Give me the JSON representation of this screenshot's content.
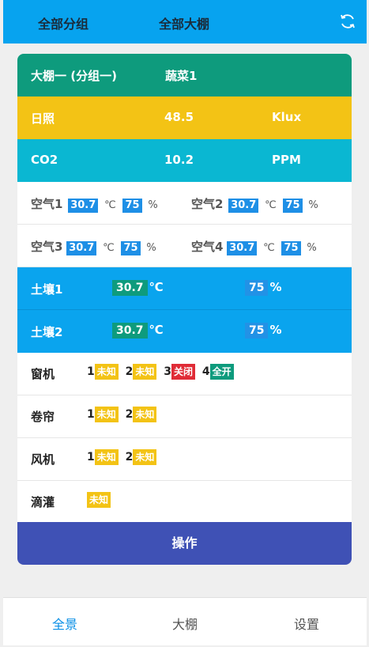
{
  "header": {
    "tab_group": "全部分组",
    "tab_greenhouse": "全部大棚",
    "refresh_icon": "refresh-icon"
  },
  "card": {
    "title": {
      "name": "大棚一 (分组一)",
      "crop": "蔬菜1"
    },
    "light": {
      "label": "日照",
      "value": "48.5",
      "unit": "Klux"
    },
    "co2": {
      "label": "CO2",
      "value": "10.2",
      "unit": "PPM"
    },
    "air": [
      {
        "label": "空气1",
        "temp": "30.7",
        "temp_unit": "℃",
        "hum": "75",
        "hum_unit": "%"
      },
      {
        "label": "空气2",
        "temp": "30.7",
        "temp_unit": "℃",
        "hum": "75",
        "hum_unit": "%"
      },
      {
        "label": "空气3",
        "temp": "30.7",
        "temp_unit": "℃",
        "hum": "75",
        "hum_unit": "%"
      },
      {
        "label": "空气4",
        "temp": "30.7",
        "temp_unit": "℃",
        "hum": "75",
        "hum_unit": "%"
      }
    ],
    "soil": [
      {
        "label": "土壤1",
        "temp": "30.7",
        "temp_unit": "℃",
        "hum": "75",
        "hum_unit": "%"
      },
      {
        "label": "土壤2",
        "temp": "30.7",
        "temp_unit": "℃",
        "hum": "75",
        "hum_unit": "%"
      }
    ],
    "devices": {
      "window": {
        "name": "窗机",
        "items": [
          {
            "n": "1",
            "state": "未知"
          },
          {
            "n": "2",
            "state": "未知"
          },
          {
            "n": "3",
            "state": "关闭"
          },
          {
            "n": "4",
            "state": "全开"
          }
        ]
      },
      "curtain": {
        "name": "卷帘",
        "items": [
          {
            "n": "1",
            "state": "未知"
          },
          {
            "n": "2",
            "state": "未知"
          }
        ]
      },
      "fan": {
        "name": "风机",
        "items": [
          {
            "n": "1",
            "state": "未知"
          },
          {
            "n": "2",
            "state": "未知"
          }
        ]
      },
      "drip": {
        "name": "滴灌",
        "state": "未知"
      }
    },
    "operate": "操作"
  },
  "nav": {
    "overview": "全景",
    "greenhouse": "大棚",
    "settings": "设置"
  },
  "colors": {
    "topbar": "#07a3ef",
    "title": "#0e9b7d",
    "light": "#f3c315",
    "co2": "#0ab7d2",
    "soil": "#0aa4ee",
    "button": "#3f51b5",
    "unknown": "#f3c315",
    "closed": "#e02c37",
    "open": "#0e9b7d"
  }
}
